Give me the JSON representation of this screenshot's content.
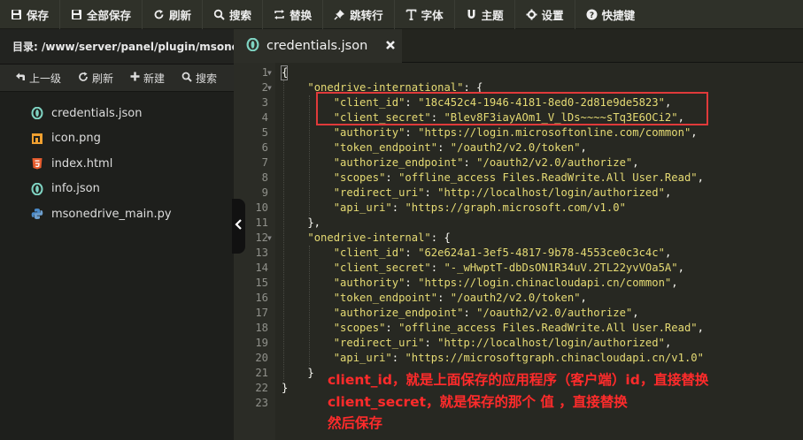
{
  "toolbar": {
    "save": "保存",
    "save_all": "全部保存",
    "refresh": "刷新",
    "search": "搜索",
    "replace": "替换",
    "goto_line": "跳转行",
    "font": "字体",
    "theme": "主题",
    "settings": "设置",
    "shortcuts": "快捷键"
  },
  "sidebar": {
    "path": "目录: /www/server/panel/plugin/msone...",
    "actions": {
      "up": "上一级",
      "refresh": "刷新",
      "new": "新建",
      "search": "搜索"
    },
    "files": [
      {
        "name": "credentials.json",
        "icon": "json-icon"
      },
      {
        "name": "icon.png",
        "icon": "image-icon"
      },
      {
        "name": "index.html",
        "icon": "html-icon"
      },
      {
        "name": "info.json",
        "icon": "json-icon"
      },
      {
        "name": "msonedrive_main.py",
        "icon": "python-icon"
      }
    ]
  },
  "tab": {
    "title": "credentials.json"
  },
  "code_lines": [
    "{",
    "    \"onedrive-international\": {",
    "        \"client_id\": \"18c452c4-1946-4181-8ed0-2d81e9de5823\",",
    "        \"client_secret\": \"Blev8F3iayAOm1_V_lDs~~~~sTq3E6OCi2\",",
    "        \"authority\": \"https://login.microsoftonline.com/common\",",
    "        \"token_endpoint\": \"/oauth2/v2.0/token\",",
    "        \"authorize_endpoint\": \"/oauth2/v2.0/authorize\",",
    "        \"scopes\": \"offline_access Files.ReadWrite.All User.Read\",",
    "        \"redirect_uri\": \"http://localhost/login/authorized\",",
    "        \"api_uri\": \"https://graph.microsoft.com/v1.0\"",
    "    },",
    "    \"onedrive-internal\": {",
    "        \"client_id\": \"62e624a1-3ef5-4817-9b78-4553ce0c3c4c\",",
    "        \"client_secret\": \"-_wHwptT-dbDsON1R34uV.2TL22yvVOa5A\",",
    "        \"authority\": \"https://login.chinacloudapi.cn/common\",",
    "        \"token_endpoint\": \"/oauth2/v2.0/token\",",
    "        \"authorize_endpoint\": \"/oauth2/v2.0/authorize\",",
    "        \"scopes\": \"offline_access Files.ReadWrite.All User.Read\",",
    "        \"redirect_uri\": \"http://localhost/login/authorized\",",
    "        \"api_uri\": \"https://microsoftgraph.chinacloudapi.cn/v1.0\"",
    "    }",
    "}",
    ""
  ],
  "annotation": {
    "line1": "client_id，就是上面保存的应用程序（客户端）id，直接替换",
    "line2": "client_secret，就是保存的那个 值 ，直接替换",
    "line3": "然后保存"
  },
  "colors": {
    "editor_bg": "#272822",
    "annotation": "#ff2b2b",
    "highlight_box": "#e03a3a"
  }
}
